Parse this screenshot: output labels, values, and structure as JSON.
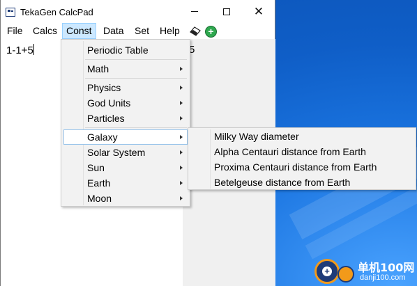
{
  "window": {
    "title": "TekaGen CalcPad",
    "controls": {
      "minimize": "minimize",
      "maximize": "maximize",
      "close": "✕"
    }
  },
  "menubar": {
    "items": [
      "File",
      "Calcs",
      "Const",
      "Data",
      "Set",
      "Help"
    ],
    "active": "Const",
    "tool_icons": [
      "eraser-icon",
      "add-icon"
    ]
  },
  "editor": {
    "content": "1-1+5",
    "result_fragment": "5"
  },
  "const_menu": {
    "items": [
      {
        "label": "Periodic Table",
        "has_submenu": false
      },
      {
        "label": "Math",
        "has_submenu": true
      },
      {
        "label": "Physics",
        "has_submenu": true
      },
      {
        "label": "God Units",
        "has_submenu": true
      },
      {
        "label": "Particles",
        "has_submenu": true
      },
      {
        "label": "Galaxy",
        "has_submenu": true,
        "highlighted": true
      },
      {
        "label": "Solar System",
        "has_submenu": true
      },
      {
        "label": "Sun",
        "has_submenu": true
      },
      {
        "label": "Earth",
        "has_submenu": true
      },
      {
        "label": "Moon",
        "has_submenu": true
      }
    ]
  },
  "galaxy_submenu": {
    "items": [
      "Milky Way diameter",
      "Alpha Centauri distance from Earth",
      "Proxima Centauri distance from Earth",
      "Betelgeuse distance from Earth"
    ]
  },
  "watermark": {
    "title": "单机100网",
    "url": "danji100.com"
  },
  "colors": {
    "menu_highlight": "#cce8ff",
    "menu_highlight_border": "#99d1ff",
    "desktop": "#1a74e0",
    "add_icon": "#2fa84f"
  }
}
